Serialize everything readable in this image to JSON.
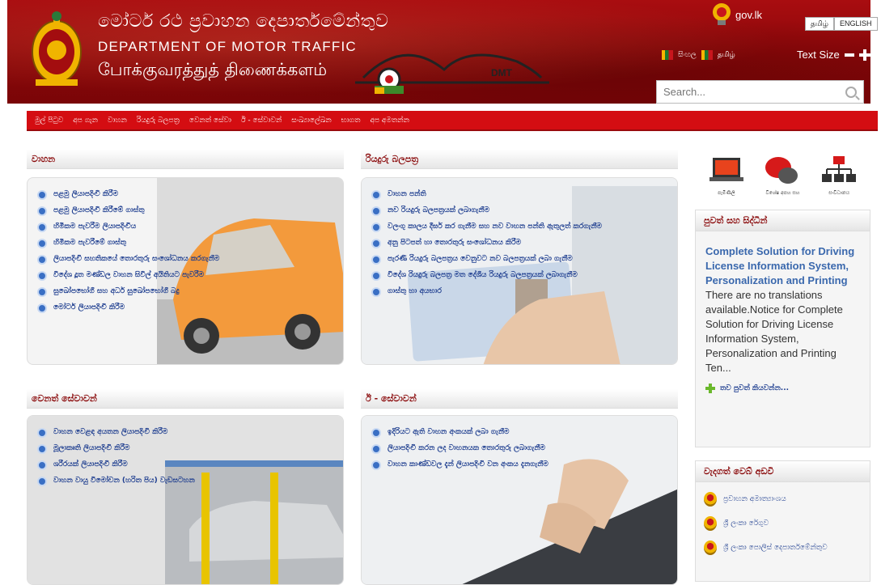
{
  "header": {
    "title_si": "මෝටර් රථ ප්‍රවාහන දෙපාර්තමේන්තුව",
    "title_en": "DEPARTMENT OF MOTOR TRAFFIC",
    "title_ta": "போக்குவரத்துத் திணைக்களம்",
    "logo_text": "DMT",
    "govlk": "gov.lk",
    "lang_tamil": "தமிழ்",
    "lang_english": "ENGLISH",
    "lang_si_small": "සිංහල",
    "lang_ta_small": "தமிழ்",
    "text_size": "Text Size",
    "search_placeholder": "Search..."
  },
  "nav": [
    "මුල් පිටුව",
    "අප ගැන",
    "වාහන",
    "රියදුරු බලපත්‍ර",
    "වෙනත් සේවා",
    "ඊ - සේවාවන්",
    "සංඛ්‍යාලේඛන",
    "භාගත",
    "අප අමතන්න"
  ],
  "vehicles": {
    "title": "වාහන",
    "items": [
      "පළමු ලියාපදිංචි කිරීම",
      "පළමු ලියාපදිංචි කිරීමේ ගාස්තු",
      "හිමිකම පැවරීම ලියාපදිංචිය",
      "හිමිකම පැවරීමේ ගාස්තු",
      "ලියාපදිංචි සහතිකයේ තොරතුරු සංශෝධනය කරගැනීම",
      "විදේශ දූත මණ්ඩල වාහන සිවිල් අයිතියට පැවරීම",
      "සුඛෝපභෝගී සහ අර්ධ සුඛෝපභෝගී බදු",
      "මෝටර් ලියාපදිංචි කිරීම"
    ]
  },
  "licenses": {
    "title": "රියදුරු බලපත්‍ර",
    "items": [
      "වාහන පන්ති",
      "නව රියදුරු බලපත්‍රයක් ලබාගැනීම",
      "වලංගු කාලය දීර්ඝ කර ගැනීම සහ නව වාහන පන්ති ඇතුලත් කරගැනීම",
      "අනු පිටපත් හා තොරතුරු සංශෝධනය කිරීම",
      "පැරණි රියදුරු බලපත්‍රය වෙනුවට නව බලපත්‍රයක් ලබා ගැනීම",
      "විදේශ රියදුරු බලපත්‍ර මත දේශීය රියදුරු බලපත්‍රයක් ලබාගැනීම",
      "ගාස්තු හා අයභාර"
    ]
  },
  "other_services": {
    "title": "වෙනත් සේවාවන්",
    "items": [
      "වාහන වෙළඳ අයතන ලියාපදිංචි කිරීම",
      "මූලාකෘති ලියාපදිංචි කිරීම",
      "ශරීරයක් ලියාපදිංචි කිරීම",
      "වාහන වායු විමෝචන (හරිත පිය) වැඩසටහන"
    ]
  },
  "eservices": {
    "title": "ඊ - සේවාවන්",
    "items": [
      "ඉදිරියට ඇති වාහන අංකයක් ලබා ගැනීම",
      "ලියාපදිංචි කරන ලද වාහනයක තොරතුරු ලබාගැනීම",
      "වාහන කාණ්ඩවල දැන් ලියාපදිංචි වන අංකය දැනගැනීම"
    ]
  },
  "right": {
    "icons": [
      "පැමිණිලි",
      "විශේෂ අපහ සහ",
      "සංවිධානය"
    ],
    "news_title": "පුවත් සහ සිද්ධීන්",
    "news_headline": "Complete Solution for Driving License Information System, Personalization and Printing",
    "news_body": "There are no translations available.Notice for Complete Solution for Driving License Information System, Personalization and Printing Ten...",
    "read_more": "තව පුවත් කියවන්න...",
    "links_title": "වැදගත් වෙබ් අඩවි",
    "links": [
      "ප්‍රවාහන අමාත්‍යාංශය",
      "ශ්‍රී ලංකා රේගුව",
      "ශ්‍රී ලංකා පොලිස් දෙපාර්තමේන්තුව"
    ]
  }
}
